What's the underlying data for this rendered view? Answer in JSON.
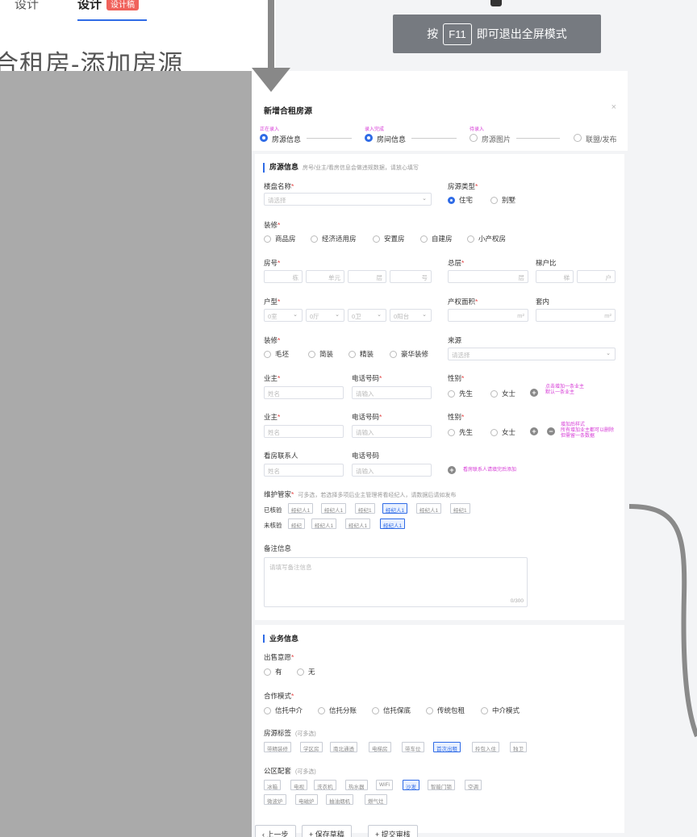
{
  "top": {
    "tab1": "设计",
    "tab2": "设计",
    "badge": "设计稿",
    "page_title": "合租房-添加房源"
  },
  "fullscreen_notice": {
    "prefix": "按",
    "key": "F11",
    "suffix": "即可退出全屏模式"
  },
  "modal": {
    "title": "新增合租房源",
    "close": "×",
    "steps": [
      {
        "tag": "正在录入",
        "label": "房源信息"
      },
      {
        "tag": "录入完成",
        "label": "房间信息"
      },
      {
        "tag": "待录入",
        "label": "房源图片"
      },
      {
        "tag": "",
        "label": "联盟/发布"
      }
    ],
    "section1": {
      "title": "房源信息",
      "sub": "房号/业主/看房信息会做违规数据，请放心填写"
    },
    "estate": {
      "label": "楼盘名称",
      "placeholder": "请选择"
    },
    "house_type": {
      "label": "房源类型",
      "options": [
        "住宅",
        "别墅"
      ]
    },
    "property": {
      "label": "装修",
      "options": [
        "商品房",
        "经济适用房",
        "安置房",
        "自建房",
        "小产权房"
      ]
    },
    "room_no": {
      "label": "房号",
      "fields": [
        "栋",
        "单元",
        "层",
        "号"
      ]
    },
    "total_floor": {
      "label": "总层",
      "unit": "层"
    },
    "ratio": {
      "label": "梯户比",
      "fields": [
        "梯",
        "户"
      ]
    },
    "layout": {
      "label": "户型",
      "fields": [
        "0室",
        "0厅",
        "0卫",
        "0阳台"
      ]
    },
    "area": {
      "label": "产权面积",
      "unit": "m²"
    },
    "inner": {
      "label": "套内",
      "unit": "m²"
    },
    "decoration": {
      "label": "装修",
      "options": [
        "毛坯",
        "简装",
        "精装",
        "豪华装修"
      ]
    },
    "source": {
      "label": "来源",
      "placeholder": "请选择"
    },
    "owner1": {
      "label": "业主",
      "placeholder": "姓名",
      "phone_label": "电话号码",
      "phone_placeholder": "请输入",
      "gender_label": "性别",
      "genders": [
        "先生",
        "女士"
      ],
      "hint1": "点击增加一条业主",
      "hint2": "默认一条业主"
    },
    "owner2": {
      "label": "业主",
      "placeholder": "姓名",
      "phone_label": "电话号码",
      "phone_placeholder": "请输入",
      "gender_label": "性别",
      "genders": [
        "先生",
        "女士"
      ],
      "hint1": "增加后样式",
      "hint2": "所有增加业主都可以删除",
      "hint3": "但需留一条数据"
    },
    "viewer": {
      "label": "看房联系人",
      "placeholder": "姓名",
      "phone_label": "电话号码",
      "phone_placeholder": "请输入",
      "hint": "看房联系人请填完后添加"
    },
    "keeper": {
      "label": "维护管家",
      "sub": "可多选，若选择多项后业主管理将看经纪人，请数据后请如发布",
      "verified_label": "已核验",
      "verified": [
        "经纪人1",
        "经纪人1",
        "经纪1",
        "经纪人1",
        "经纪人1",
        "经纪1"
      ],
      "unverified_label": "未核验",
      "unverified": [
        "经纪",
        "经纪人1",
        "经纪人1",
        "经纪人1"
      ]
    },
    "remark": {
      "label": "备注信息",
      "placeholder": "请填写备注信息",
      "counter": "0/300"
    },
    "section2": {
      "title": "业务信息"
    },
    "sale": {
      "label": "出售意愿",
      "options": [
        "有",
        "无"
      ]
    },
    "coop": {
      "label": "合作模式",
      "options": [
        "信托中介",
        "信托分账",
        "信托保底",
        "传统包租",
        "中介模式"
      ]
    },
    "tags": {
      "label": "房源标签",
      "sub": "(可多选)",
      "items": [
        "带精装修",
        "学区房",
        "南北通透",
        "电梯房",
        "带车位",
        "首次出租",
        "拎包入住",
        "独卫"
      ]
    },
    "facilities": {
      "label": "公区配套",
      "sub": "(可多选)",
      "items": [
        "冰箱",
        "电视",
        "洗衣机",
        "热水器",
        "WiFi",
        "沙发",
        "智能门锁",
        "空调",
        "微波炉",
        "电磁炉",
        "抽油烟机",
        "燃气灶"
      ]
    },
    "buttons": [
      "上一步",
      "保存草稿",
      "提交审核"
    ]
  }
}
